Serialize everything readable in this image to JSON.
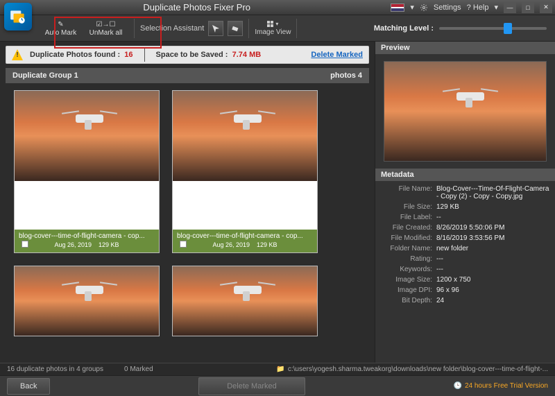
{
  "title": "Duplicate Photos Fixer Pro",
  "titlebar": {
    "settings": "Settings",
    "help": "? Help"
  },
  "toolbar": {
    "automark": "Auto Mark",
    "unmarkall": "UnMark all",
    "selection_assistant": "Selection Assistant",
    "image_view": "Image View",
    "matching_level": "Matching Level :"
  },
  "infobar": {
    "dup_label": "Duplicate Photos found :",
    "dup_count": "16",
    "space_label": "Space to be Saved :",
    "space_value": "7.74 MB",
    "delete_marked": "Delete Marked"
  },
  "group": {
    "name": "Duplicate Group 1",
    "photos": "photos 4"
  },
  "thumbs": [
    {
      "filename": "blog-cover---time-of-flight-camera - cop...",
      "date": "Aug 26, 2019",
      "size": "129 KB",
      "full": true
    },
    {
      "filename": "blog-cover---time-of-flight-camera - cop...",
      "date": "Aug 26, 2019",
      "size": "129 KB",
      "full": true
    },
    {
      "filename": "",
      "date": "",
      "size": "",
      "full": false
    },
    {
      "filename": "",
      "date": "",
      "size": "",
      "full": false
    }
  ],
  "preview": {
    "title": "Preview"
  },
  "metadata": {
    "title": "Metadata",
    "rows": [
      {
        "key": "File Name:",
        "val": "Blog-Cover---Time-Of-Flight-Camera - Copy (2) - Copy - Copy.jpg"
      },
      {
        "key": "File Size:",
        "val": "129 KB"
      },
      {
        "key": "File Label:",
        "val": "--"
      },
      {
        "key": "File Created:",
        "val": "8/26/2019 5:50:06 PM"
      },
      {
        "key": "File Modified:",
        "val": "8/16/2019 3:53:56 PM"
      },
      {
        "key": "Folder Name:",
        "val": "new folder"
      },
      {
        "key": "Rating:",
        "val": "---"
      },
      {
        "key": "Keywords:",
        "val": "---"
      },
      {
        "key": "Image Size:",
        "val": "1200 x 750"
      },
      {
        "key": "Image DPI:",
        "val": "96 x 96"
      },
      {
        "key": "Bit Depth:",
        "val": "24"
      }
    ]
  },
  "statusbar": {
    "summary": "16 duplicate photos in 4 groups",
    "marked": "0 Marked",
    "path": "c:\\users\\yogesh.sharma.tweakorg\\downloads\\new folder\\blog-cover---time-of-flight-..."
  },
  "bottombar": {
    "back": "Back",
    "delete": "Delete Marked",
    "trial": "24 hours Free Trial Version"
  }
}
